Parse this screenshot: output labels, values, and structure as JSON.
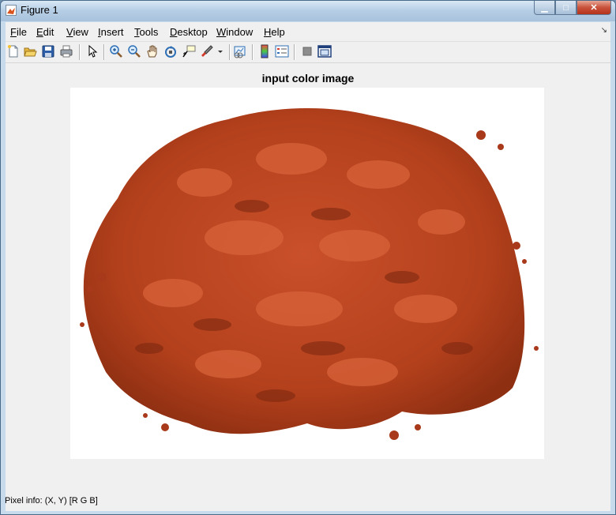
{
  "window": {
    "title": "Figure 1"
  },
  "caption_buttons": {
    "minimize": "▁",
    "maximize": "□",
    "close": "✕"
  },
  "menu": {
    "items": [
      {
        "u": "F",
        "rest": "ile"
      },
      {
        "u": "E",
        "rest": "dit"
      },
      {
        "u": "V",
        "rest": "iew"
      },
      {
        "u": "I",
        "rest": "nsert"
      },
      {
        "u": "T",
        "rest": "ools"
      },
      {
        "u": "D",
        "rest": "esktop"
      },
      {
        "u": "W",
        "rest": "indow"
      },
      {
        "u": "H",
        "rest": "elp"
      }
    ],
    "dock_arrow": "↘"
  },
  "toolbar": {
    "icons": [
      "new-figure-icon",
      "open-file-icon",
      "save-icon",
      "print-icon",
      "edit-plot-arrow-icon",
      "zoom-in-icon",
      "zoom-out-icon",
      "pan-hand-icon",
      "rotate-3d-icon",
      "data-cursor-icon",
      "brush-icon",
      "brush-dropdown-icon",
      "link-plot-icon",
      "insert-colorbar-icon",
      "insert-legend-icon",
      "hide-plot-tools-icon",
      "show-plot-tools-icon"
    ]
  },
  "figure": {
    "axes_title": "input color image",
    "image": {
      "subject": "red chili powder pile",
      "main_color": "#b3401c",
      "dark_color": "#7d2810",
      "light_color": "#d8633a",
      "background": "#ffffff"
    }
  },
  "status": {
    "pixel_info": "Pixel info: (X, Y)  [R G B]"
  }
}
